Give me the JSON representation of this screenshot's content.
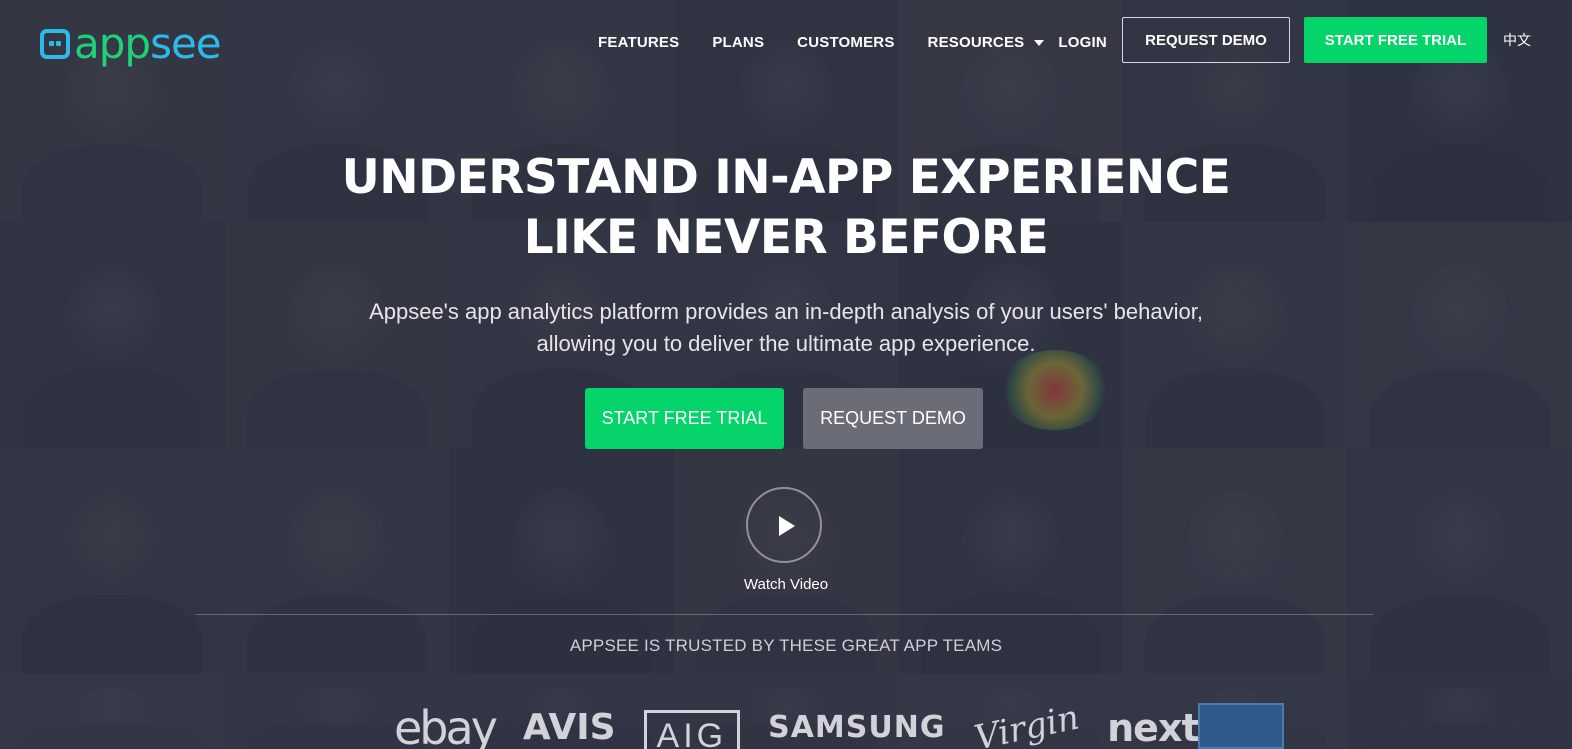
{
  "header": {
    "logo_text": "appsee",
    "nav": [
      {
        "label": "FEATURES"
      },
      {
        "label": "PLANS"
      },
      {
        "label": "CUSTOMERS"
      },
      {
        "label": "RESOURCES",
        "has_dropdown": true
      },
      {
        "label": "LOGIN"
      }
    ],
    "request_demo_label": "REQUEST DEMO",
    "start_trial_label": "START FREE TRIAL",
    "language_label": "中文"
  },
  "hero": {
    "title_line1": "UNDERSTAND IN-APP EXPERIENCE",
    "title_line2": "LIKE NEVER BEFORE",
    "subtitle_line1": "Appsee's app analytics platform provides an in-depth analysis of your users' behavior,",
    "subtitle_line2": "allowing you to deliver the ultimate app experience.",
    "cta_primary": "START FREE TRIAL",
    "cta_secondary": "REQUEST DEMO",
    "watch_video_label": "Watch Video"
  },
  "trusted": {
    "heading": "APPSEE IS TRUSTED BY THESE GREAT APP TEAMS",
    "brands": [
      "ebay",
      "AVIS",
      "AIG",
      "SAMSUNG",
      "Virgin",
      "nextel"
    ]
  },
  "colors": {
    "accent_green": "#04d46a",
    "logo_blue": "#2bbbe8",
    "overlay": "#2d3040"
  }
}
